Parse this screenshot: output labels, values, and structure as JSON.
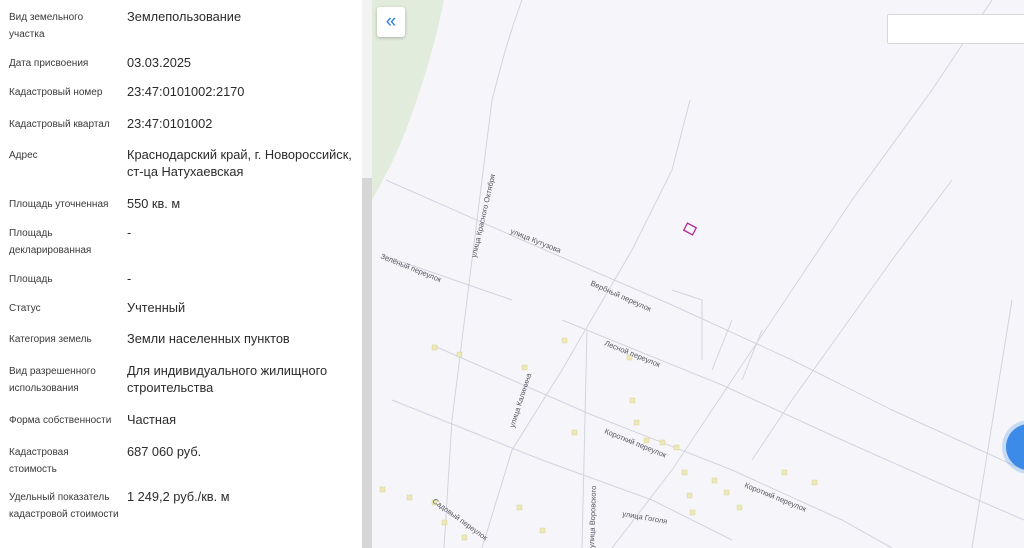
{
  "info_panel": {
    "rows": [
      {
        "label": "Вид земельного участка",
        "value": "Землепользование"
      },
      {
        "label": "Дата присвоения",
        "value": "03.03.2025"
      },
      {
        "label": "Кадастровый номер",
        "value": "23:47:0101002:2170"
      },
      {
        "label": "Кадастровый квартал",
        "value": "23:47:0101002"
      },
      {
        "label": "Адрес",
        "value": "Краснодарский край, г. Новороссийск, ст-ца Натухаевская"
      },
      {
        "label": "Площадь уточненная",
        "value": "550 кв. м"
      },
      {
        "label": "Площадь декларированная",
        "value": "-"
      },
      {
        "label": "Площадь",
        "value": "-"
      },
      {
        "label": "Статус",
        "value": "Учтенный"
      },
      {
        "label": "Категория земель",
        "value": "Земли населенных пунктов"
      },
      {
        "label": "Вид разрешенного использования",
        "value": "Для индивидуального жилищного строительства"
      },
      {
        "label": "Форма собственности",
        "value": "Частная"
      },
      {
        "label": "Кадастровая стоимость",
        "value": "687 060 руб."
      },
      {
        "label": "Удельный показатель кадастровой стоимости",
        "value": "1 249,2 руб./кв. м"
      }
    ]
  },
  "map": {
    "collapse_icon": "double-chevron-left-icon",
    "collapse_glyph": "«",
    "search_value": "",
    "accent_color": "#2f7de1",
    "parcel_color": "#b0279a",
    "streets": {
      "krasnogo_oktyabrya": "улица Красного Октября",
      "kutuzova": "улица Кутузова",
      "zeleny": "Зелёный переулок",
      "verbny": "Вербный переулок",
      "lesnoy": "Лесной переулок",
      "kalinina": "улица Калинина",
      "korotky_1": "Короткий переулок",
      "korotky_2": "Короткий переулок",
      "vorovskogo": "улица Воровского",
      "gogolya": "улица Гоголя",
      "sadovy": "Садовый переулок"
    }
  }
}
